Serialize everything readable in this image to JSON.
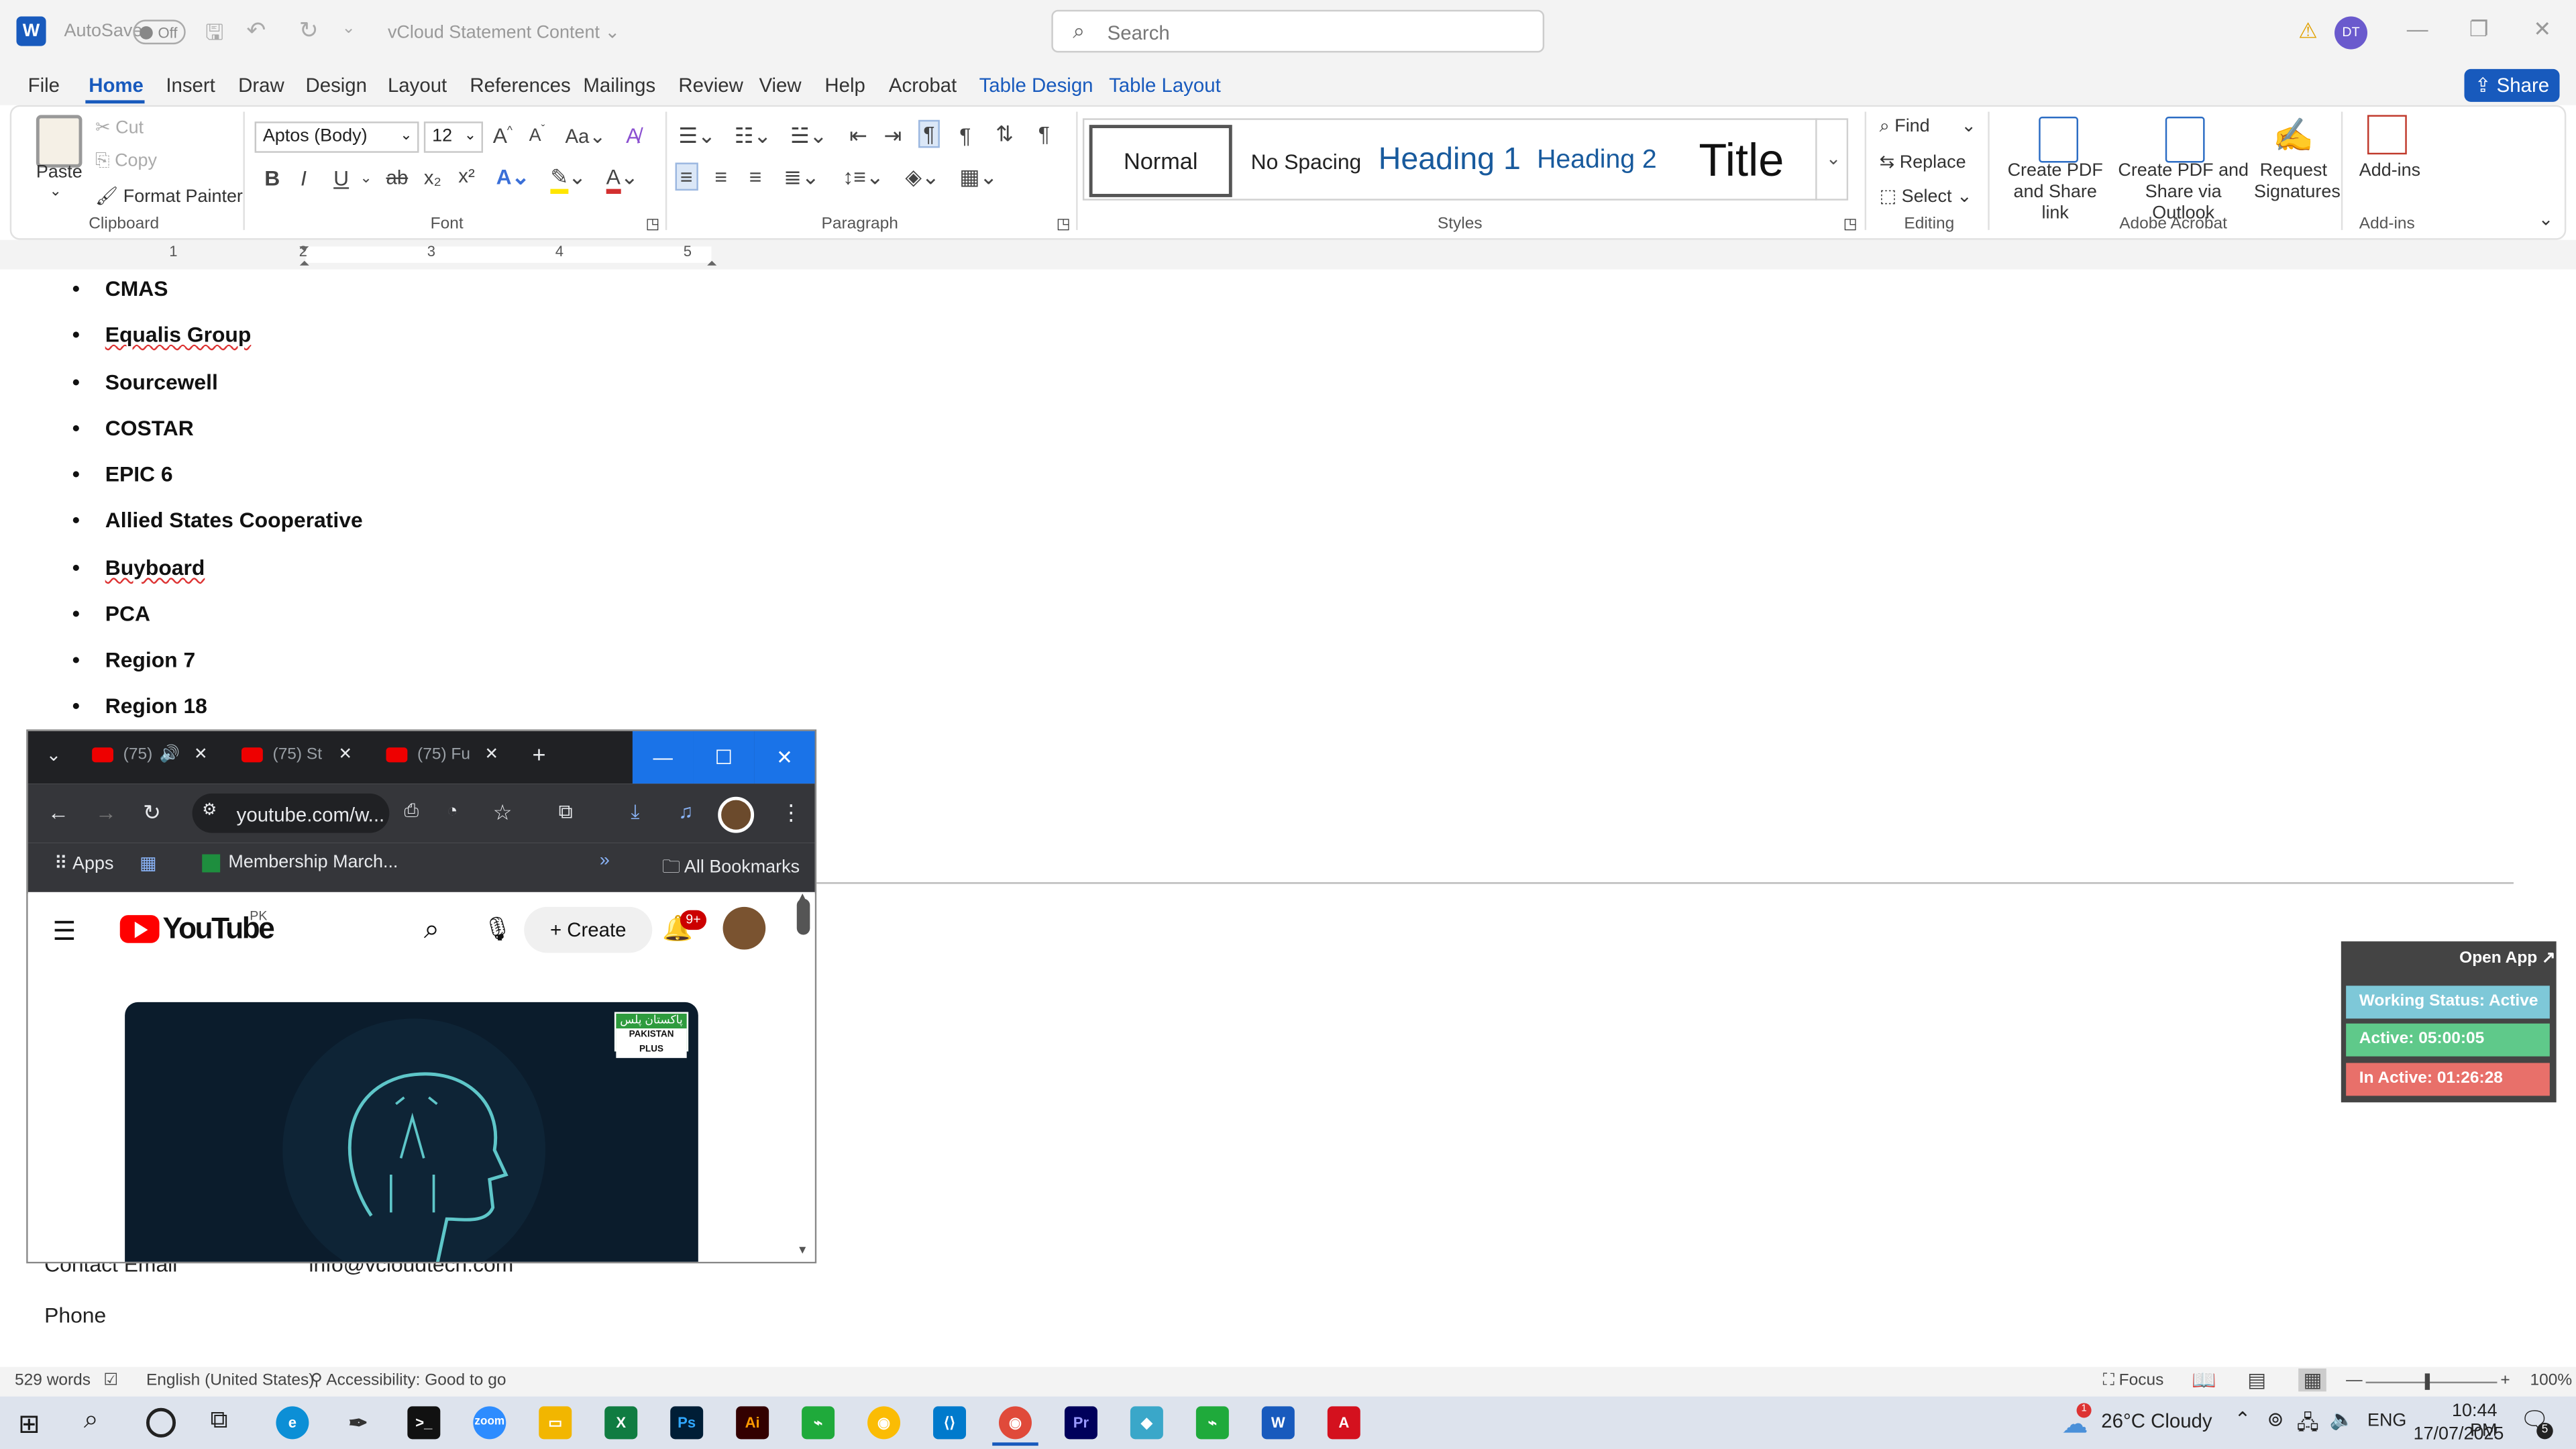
{
  "titlebar": {
    "app_icon": "W",
    "autosave_label": "AutoSave",
    "autosave_state": "Off",
    "doc_title": "vCloud Statement Content",
    "search_placeholder": "Search",
    "user_initials": "DT"
  },
  "menu": {
    "items": [
      "File",
      "Home",
      "Insert",
      "Draw",
      "Design",
      "Layout",
      "References",
      "Mailings",
      "Review",
      "View",
      "Help",
      "Acrobat",
      "Table Design",
      "Table Layout"
    ],
    "share_label": "Share"
  },
  "ribbon": {
    "clipboard": {
      "paste": "Paste",
      "cut": "Cut",
      "copy": "Copy",
      "format_painter": "Format Painter",
      "group": "Clipboard"
    },
    "font": {
      "name": "Aptos (Body)",
      "size": "12",
      "group": "Font"
    },
    "paragraph": {
      "group": "Paragraph"
    },
    "styles": {
      "items": [
        "Normal",
        "No Spacing",
        "Heading 1",
        "Heading 2",
        "Title"
      ],
      "group": "Styles"
    },
    "editing": {
      "find": "Find",
      "replace": "Replace",
      "select": "Select",
      "group": "Editing"
    },
    "acrobat": {
      "create_pdf": "Create PDF and Share link",
      "create_pdf_outlook": "Create PDF and Share via Outlook",
      "request_sig": "Request Signatures",
      "group": "Adobe Acrobat"
    },
    "addins": {
      "label": "Add-ins",
      "group": "Add-ins"
    }
  },
  "ruler": {
    "numbers": [
      "1",
      "2",
      "3",
      "4",
      "5"
    ]
  },
  "document": {
    "bullets": [
      "CMAS",
      "Equalis Group",
      "Sourcewell",
      "COSTAR",
      "EPIC 6",
      "Allied States Cooperative",
      "Buyboard",
      "PCA",
      "Region 7",
      "Region 18"
    ],
    "contact_email_label": "Contact Email",
    "contact_email_value": "info@vcloudtech.com",
    "phone_label": "Phone"
  },
  "statusbar": {
    "words": "529 words",
    "language": "English (United States)",
    "accessibility": "Accessibility: Good to go",
    "focus": "Focus",
    "zoom": "100%"
  },
  "browser": {
    "tabs": [
      "(75)",
      "(75) St",
      "(75) Fu"
    ],
    "url": "youtube.com/w...",
    "bookmarks": {
      "apps": "Apps",
      "membership": "Membership March...",
      "all": "All Bookmarks"
    },
    "youtube": {
      "logo": "YouTube",
      "region": "PK",
      "create": "Create",
      "notif_count": "9+",
      "channel_badge_top": "پاکستان پلس",
      "channel_badge_bottom": "PAKISTAN PLUS"
    }
  },
  "widget": {
    "open_app": "Open App ↗",
    "status": "Working Status: Active",
    "active": "Active: 05:00:05",
    "inactive": "In Active: 01:26:28",
    "colors": {
      "status": "#7ec8d8",
      "active": "#5fc98a",
      "inactive": "#e8706a"
    }
  },
  "taskbar": {
    "weather": "26°C Cloudy",
    "lang": "ENG",
    "time": "10:44 PM",
    "date": "17/07/2025",
    "weather_badge": "1",
    "notif_count": "5"
  }
}
